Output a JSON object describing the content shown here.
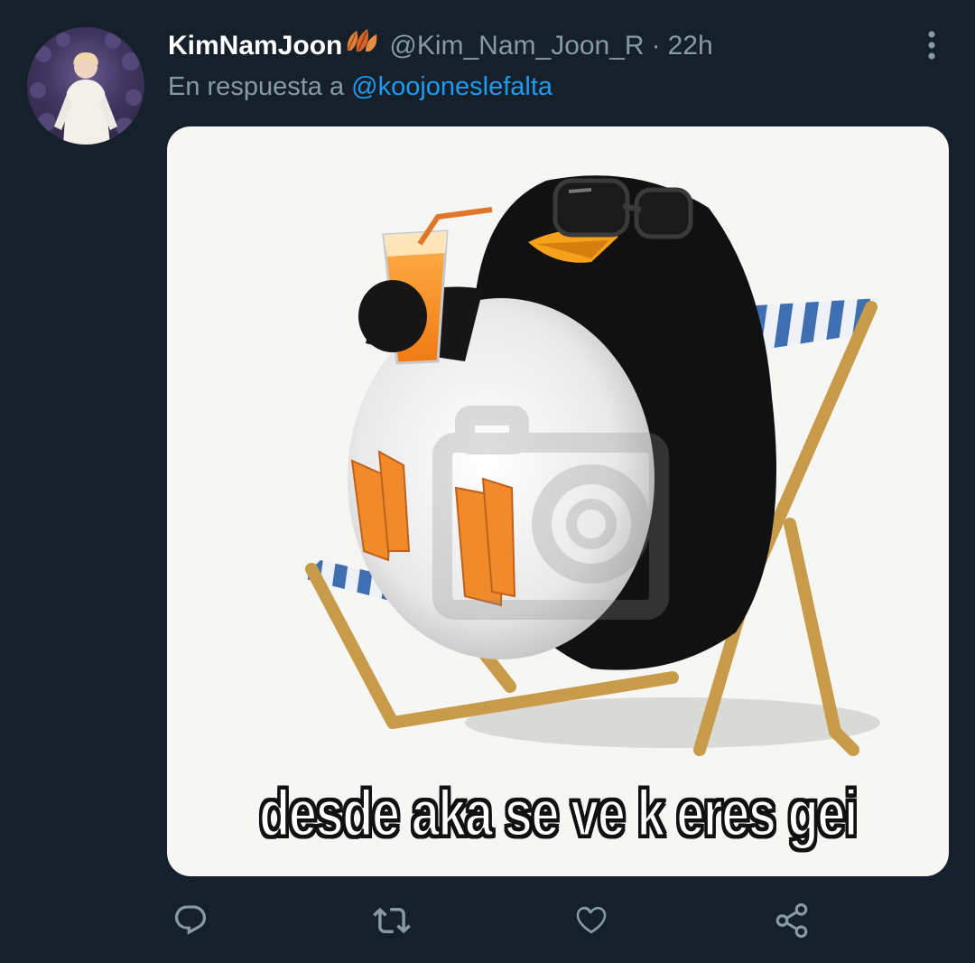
{
  "tweet": {
    "display_name": "KimNamJoon",
    "handle": "@Kim_Nam_Joon_R",
    "separator": "·",
    "time": "22h",
    "reply_prefix": "En respuesta a",
    "reply_to": "@koojoneslefalta",
    "name_emoji": "leaves-emoji"
  },
  "media": {
    "caption": "desde aka se ve k eres gei"
  },
  "actions": {
    "icons": [
      "reply-icon",
      "retweet-icon",
      "like-icon",
      "share-icon"
    ]
  },
  "colors": {
    "background": "#15202b",
    "text_primary": "#ffffff",
    "text_secondary": "#8899a6",
    "accent": "#1d9bf0"
  }
}
